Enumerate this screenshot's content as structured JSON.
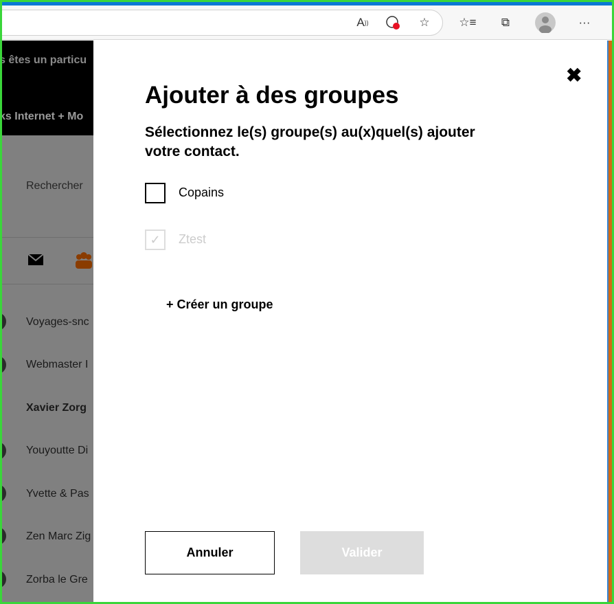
{
  "browser": {
    "icons": [
      "read-aloud-icon",
      "cookie-blocked-icon",
      "add-favorite-icon",
      "favorites-icon",
      "collections-icon",
      "profile-icon",
      "more-icon"
    ],
    "more_label": "···"
  },
  "background": {
    "banner_top": "s êtes un particu",
    "banner_bottom": "ks Internet + Mo",
    "search_placeholder": "Rechercher",
    "contacts": [
      "Voyages-snc",
      "Webmaster I",
      "Xavier Zorg",
      "Youyoutte Di",
      "Yvette & Pas",
      "Zen Marc Zig",
      "Zorba le Gre"
    ]
  },
  "modal": {
    "close_label": "✖",
    "title": "Ajouter à des groupes",
    "subtitle": "Sélectionnez le(s) groupe(s) au(x)quel(s) ajouter votre contact.",
    "groups": [
      {
        "label": "Copains",
        "checked": false,
        "disabled": false
      },
      {
        "label": "Ztest",
        "checked": true,
        "disabled": true
      }
    ],
    "create_group": "+ Créer un groupe",
    "cancel": "Annuler",
    "validate": "Valider"
  }
}
